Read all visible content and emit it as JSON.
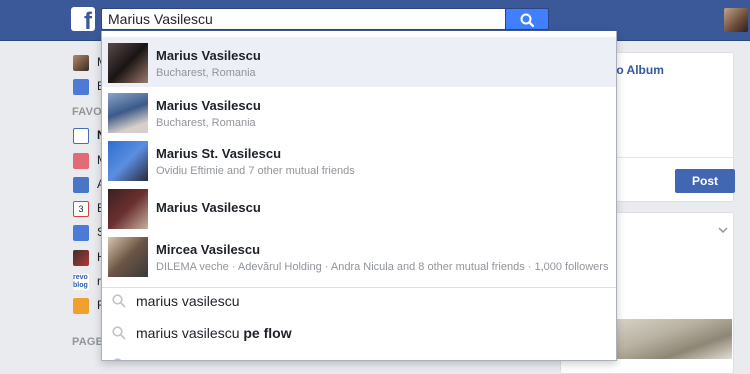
{
  "search": {
    "query": "Marius Vasilescu"
  },
  "logo": {
    "letter": "f"
  },
  "left_nav": {
    "items_top": [
      "M",
      "E"
    ],
    "favorites_heading": "FAVO",
    "favorites": [
      "N",
      "M",
      "A",
      "E",
      "S",
      "H",
      "re",
      "R"
    ],
    "pages_heading": "PAGE"
  },
  "right_card": {
    "link": "oto Album",
    "post_label": "Post"
  },
  "results": [
    {
      "name": "Marius Vasilescu",
      "subtitle": "Bucharest, Romania"
    },
    {
      "name": "Marius Vasilescu",
      "subtitle": "Bucharest, Romania"
    },
    {
      "name": "Marius St. Vasilescu",
      "subtitle": "Ovidiu Eftimie and 7 other mutual friends"
    },
    {
      "name": "Marius Vasilescu",
      "subtitle": ""
    },
    {
      "name": "Mircea Vasilescu",
      "subtitle": "DILEMA veche · Adevărul Holding · Andra Nicula and 8 other mutual friends · 1,000 followers"
    }
  ],
  "suggestions": [
    {
      "text": "marius vasilescu",
      "bold_suffix": ""
    },
    {
      "text": "marius vasilescu",
      "bold_suffix": "pe flow"
    }
  ],
  "colors": {
    "brand": "#3b5998",
    "search_button": "#4080ff",
    "post_button": "#4267b2"
  }
}
